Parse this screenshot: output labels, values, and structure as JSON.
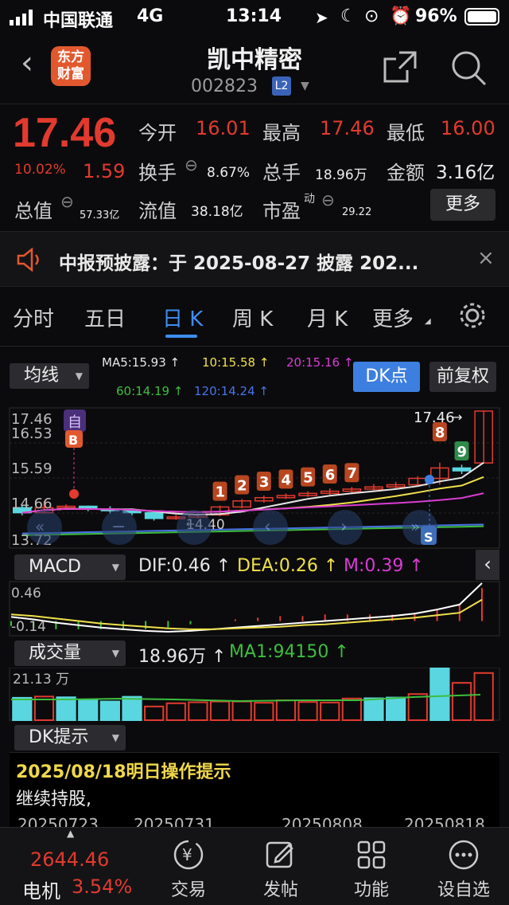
{
  "status": {
    "carrier": "中国联通",
    "network": "4G",
    "time": "13:14",
    "battery": "96%"
  },
  "header": {
    "logo": "东方\n财富",
    "name": "凯中精密",
    "code": "002823",
    "badge": "L2"
  },
  "quote": {
    "price": "17.46",
    "change_pct": "10.02%",
    "change": "1.59",
    "open_label": "今开",
    "open": "16.01",
    "high_label": "最高",
    "high": "17.46",
    "low_label": "最低",
    "low": "16.00",
    "turnover_label": "换手",
    "turnover": "8.67%",
    "volume_label": "总手",
    "volume": "18.96万",
    "amount_label": "金额",
    "amount": "3.16亿",
    "mktcap_label": "总值",
    "mktcap": "57.33亿",
    "float_label": "流值",
    "float": "38.18亿",
    "pe_label": "市盈",
    "pe_sup": "动",
    "pe": "29.22",
    "more": "更多"
  },
  "notice": {
    "text": "中报预披露：于 2025-08-27 披露 202..."
  },
  "tabs": {
    "t1": "分时",
    "t2": "五日",
    "t3": "日 K",
    "t4": "周 K",
    "t5": "月 K",
    "t6": "更多"
  },
  "ma": {
    "btn": "均线",
    "ma5": "MA5:15.93 ↑",
    "ma10": "10:15.58 ↑",
    "ma20": "20:15.16 ↑",
    "ma60": "60:14.19 ↑",
    "ma120": "120:14.24 ↑",
    "dk": "DK点",
    "fq": "前复权"
  },
  "kaxis": {
    "y1": "17.46",
    "y2": "16.53",
    "y3": "15.59",
    "y4": "14.66",
    "y5": "13.72",
    "last": "17.46",
    "low": "14.40"
  },
  "macd": {
    "btn": "MACD",
    "dif": "DIF:0.46 ↑",
    "dea": "DEA:0.26 ↑",
    "m": "M:0.39 ↑",
    "y1": "0.46",
    "y2": "-0.14"
  },
  "vol": {
    "btn": "成交量",
    "value": "18.96万 ↑",
    "ma1": "MA1:94150 ↑",
    "y1": "21.13 万"
  },
  "dk": {
    "btn": "DK提示",
    "date_title": "2025/08/18明日操作提示",
    "advice": "继续持股,"
  },
  "dates": {
    "d1": "20250723",
    "d2": "20250731",
    "d3": "20250808",
    "d4": "20250818"
  },
  "bottom": {
    "index_value": "2644.46",
    "index_name": "电机",
    "index_pct": "3.54%",
    "trade": "交易",
    "post": "发帖",
    "func": "功能",
    "watch": "设自选"
  },
  "colors": {
    "up": "#e23a2e",
    "down": "#5ad6e0",
    "accent": "#3d8ef0"
  },
  "chart_data": [
    {
      "type": "candlestick",
      "title": "日K",
      "ylim": [
        13.72,
        17.46
      ],
      "candles": [
        {
          "open": 14.76,
          "close": 14.62,
          "high": 14.82,
          "low": 14.55
        },
        {
          "open": 14.62,
          "close": 14.76,
          "high": 14.95,
          "low": 14.6
        },
        {
          "open": 14.76,
          "close": 14.8,
          "high": 14.85,
          "low": 14.7
        },
        {
          "open": 14.8,
          "close": 14.72,
          "high": 14.82,
          "low": 14.66
        },
        {
          "open": 14.72,
          "close": 14.68,
          "high": 14.8,
          "low": 14.6
        },
        {
          "open": 14.68,
          "close": 14.62,
          "high": 14.72,
          "low": 14.55
        },
        {
          "open": 14.62,
          "close": 14.46,
          "high": 14.66,
          "low": 14.4
        },
        {
          "open": 14.46,
          "close": 14.5,
          "high": 14.56,
          "low": 14.42
        },
        {
          "open": 14.5,
          "close": 14.56,
          "high": 14.62,
          "low": 14.46
        },
        {
          "open": 14.56,
          "close": 14.78,
          "high": 14.82,
          "low": 14.52
        },
        {
          "open": 14.78,
          "close": 14.95,
          "high": 15.0,
          "low": 14.74
        },
        {
          "open": 14.95,
          "close": 15.04,
          "high": 15.1,
          "low": 14.9
        },
        {
          "open": 15.04,
          "close": 15.1,
          "high": 15.16,
          "low": 15.0
        },
        {
          "open": 15.1,
          "close": 15.16,
          "high": 15.22,
          "low": 15.06
        },
        {
          "open": 15.16,
          "close": 15.22,
          "high": 15.3,
          "low": 15.12
        },
        {
          "open": 15.22,
          "close": 15.28,
          "high": 15.34,
          "low": 15.18
        },
        {
          "open": 15.28,
          "close": 15.34,
          "high": 15.42,
          "low": 15.24
        },
        {
          "open": 15.34,
          "close": 15.4,
          "high": 15.48,
          "low": 15.3
        },
        {
          "open": 15.4,
          "close": 15.58,
          "high": 15.64,
          "low": 15.36
        },
        {
          "open": 15.58,
          "close": 15.87,
          "high": 16.02,
          "low": 15.4
        },
        {
          "open": 15.87,
          "close": 15.79,
          "high": 15.96,
          "low": 15.7
        },
        {
          "open": 16.01,
          "close": 17.46,
          "high": 17.46,
          "low": 16.0
        }
      ],
      "markers": [
        "1",
        "2",
        "3",
        "4",
        "5",
        "6",
        "7",
        "8",
        "9"
      ],
      "ma_lines": [
        "MA5",
        "MA10",
        "MA20",
        "MA60",
        "MA120"
      ]
    },
    {
      "type": "line",
      "title": "MACD",
      "ylim": [
        -0.14,
        0.46
      ],
      "series": [
        {
          "name": "DIF",
          "values": [
            0.05,
            0.02,
            -0.02,
            -0.05,
            -0.08,
            -0.1,
            -0.12,
            -0.13,
            -0.12,
            -0.1,
            -0.08,
            -0.06,
            -0.04,
            -0.02,
            0.0,
            0.02,
            0.04,
            0.06,
            0.09,
            0.14,
            0.2,
            0.46
          ]
        },
        {
          "name": "DEA",
          "values": [
            0.08,
            0.06,
            0.03,
            0.0,
            -0.03,
            -0.05,
            -0.07,
            -0.09,
            -0.1,
            -0.1,
            -0.09,
            -0.08,
            -0.07,
            -0.05,
            -0.04,
            -0.02,
            0.0,
            0.02,
            0.04,
            0.07,
            0.1,
            0.26
          ]
        }
      ]
    },
    {
      "type": "bar",
      "title": "成交量",
      "ylim": [
        0,
        21.13
      ],
      "values": [
        9.0,
        9.5,
        9.2,
        8.0,
        7.5,
        9.4,
        5.5,
        6.8,
        7.2,
        7.5,
        7.5,
        7.0,
        8.0,
        7.3,
        7.1,
        8.7,
        8.8,
        9.1,
        10.5,
        21.1,
        15.0,
        18.96
      ],
      "up": [
        false,
        true,
        false,
        false,
        false,
        false,
        true,
        true,
        true,
        true,
        true,
        true,
        true,
        true,
        true,
        true,
        false,
        false,
        true,
        false,
        true,
        true
      ]
    }
  ]
}
